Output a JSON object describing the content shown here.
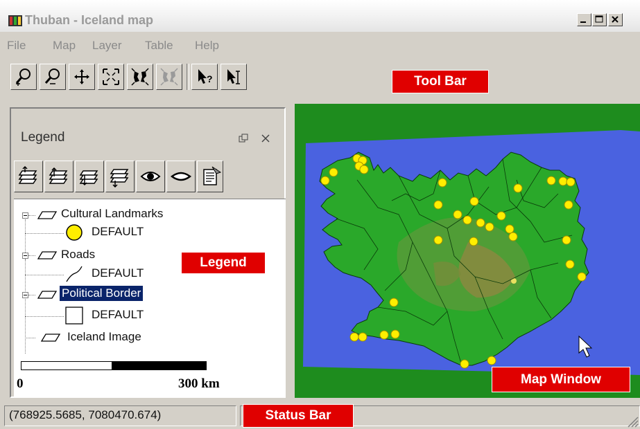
{
  "window": {
    "title": "Thuban - Iceland map",
    "controls": {
      "minimize": "_",
      "maximize": "□",
      "close": "X"
    }
  },
  "menu": [
    "File",
    "Map",
    "Layer",
    "Table",
    "Help"
  ],
  "toolbar": {
    "buttons": [
      "zoom-in",
      "zoom-out",
      "pan",
      "full-extent",
      "fit-layer",
      "fit-selected",
      "identify",
      "label"
    ],
    "identify_label": "?"
  },
  "annotations": {
    "toolbar": "Tool Bar",
    "legend": "Legend",
    "map": "Map Window",
    "status": "Status Bar"
  },
  "legend": {
    "title": "Legend",
    "buttons": [
      "move-layer-top",
      "move-layer-up",
      "move-layer-down",
      "move-layer-bottom",
      "show-layer",
      "hide-layer",
      "layer-properties"
    ],
    "layers": [
      {
        "name": "Cultural Landmarks",
        "classes": [
          {
            "label": "DEFAULT",
            "symbol": "yellow-circle"
          }
        ]
      },
      {
        "name": "Roads",
        "classes": [
          {
            "label": "DEFAULT",
            "symbol": "line"
          }
        ]
      },
      {
        "name": "Political Border",
        "selected": true,
        "classes": [
          {
            "label": "DEFAULT",
            "symbol": "white-box"
          }
        ]
      },
      {
        "name": "Iceland Image",
        "classes": []
      }
    ],
    "scalebar": {
      "start": "0",
      "end": "300 km"
    }
  },
  "status": {
    "coordinates": "(768925.5685, 7080470.674)"
  },
  "colors": {
    "map_background": "#1e8c1e",
    "sea": "#4a62e0",
    "land": "#2aa82a",
    "landmark": "#ffee00",
    "annotation_red": "#e00000",
    "selection": "#0a246a"
  }
}
